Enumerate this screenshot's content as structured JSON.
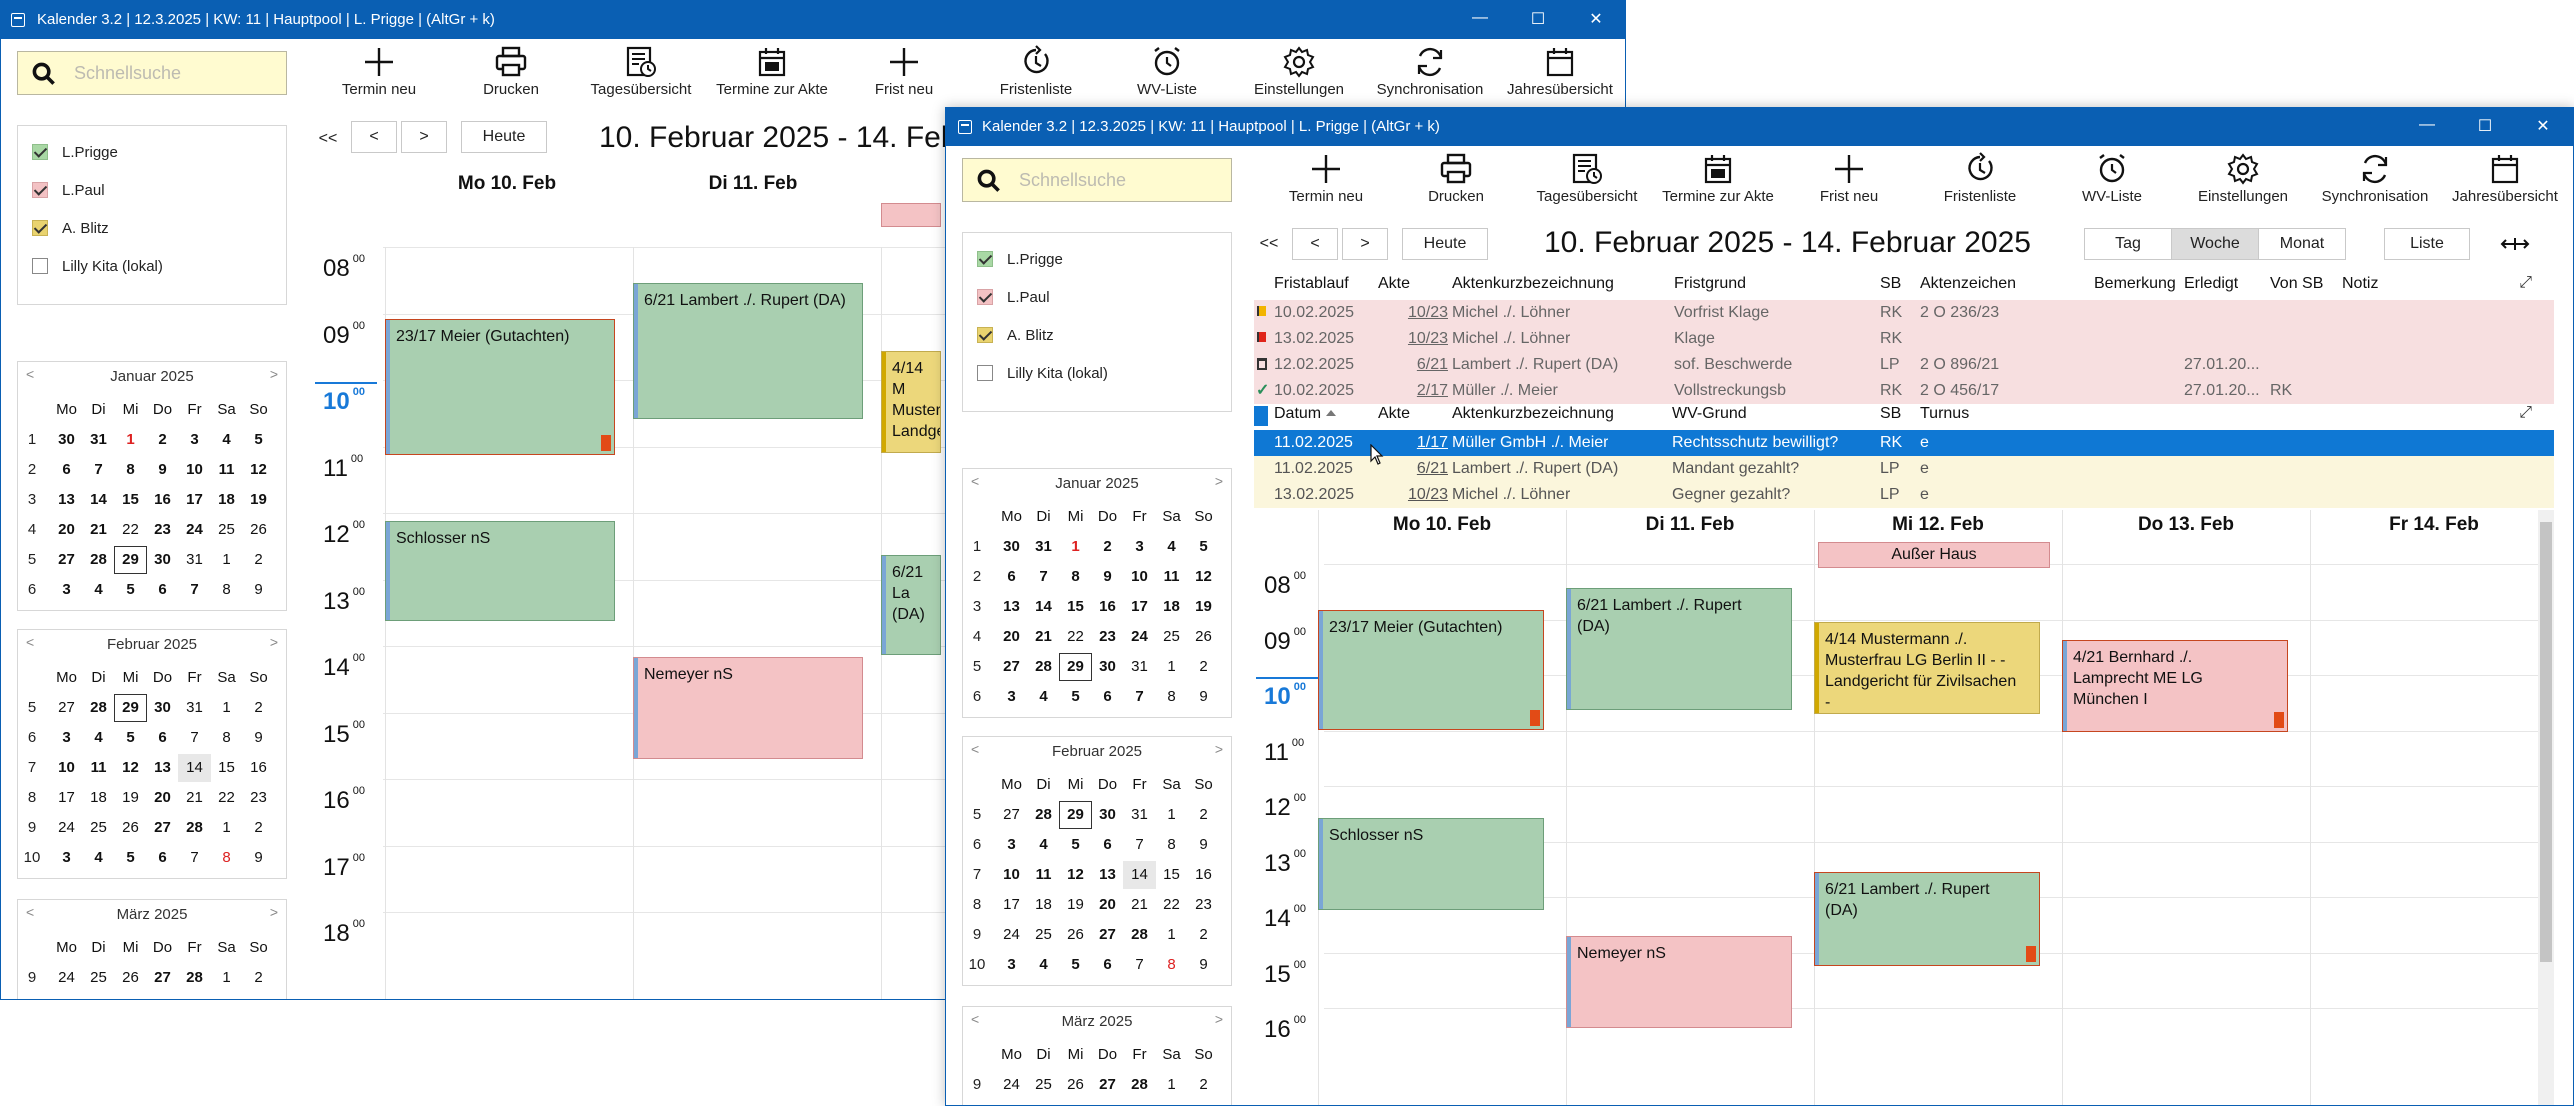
{
  "back_window": {
    "title": "Kalender 3.2 | 12.3.2025 | KW: 11 | Hauptpool | L. Prigge | (AltGr + k)",
    "controls": [
      "—",
      "☐",
      "✕"
    ],
    "search_placeholder": "Schnellsuche",
    "toolbar": [
      "Termin neu",
      "Drucken",
      "Tagesübersicht",
      "Termine zur Akte",
      "Frist neu",
      "Fristenliste",
      "WV-Liste",
      "Einstellungen",
      "Synchronisation",
      "Jahresübersicht"
    ],
    "calendars": [
      {
        "label": "L.Prigge",
        "checked": true,
        "color": "#a9d8a5"
      },
      {
        "label": "L.Paul",
        "checked": true,
        "color": "#f3c2c4"
      },
      {
        "label": "A. Blitz",
        "checked": true,
        "color": "#e9d36f"
      },
      {
        "label": "Lilly Kita (lokal)",
        "checked": false,
        "color": "#ffffff"
      }
    ],
    "nav": {
      "first": "<<",
      "prev": "<",
      "next": ">",
      "today": "Heute"
    },
    "range_title": "10. Februar 2025 - 14. Febr",
    "days": [
      "Mo 10. Feb",
      "Di 11. Feb"
    ],
    "hours": [
      "08",
      "09",
      "10",
      "11",
      "12",
      "13",
      "14",
      "15",
      "16",
      "17",
      "18"
    ],
    "minutes": "00",
    "events": [
      {
        "text": "23/17 Meier (Gutachten)"
      },
      {
        "text": "6/21 Lambert ./. Rupert (DA)"
      },
      {
        "text": "4/14 M\nMuster\nLandge\n-"
      },
      {
        "text": "Schlosser nS"
      },
      {
        "text": "6/21 La\n(DA)"
      },
      {
        "text": "Nemeyer nS"
      }
    ]
  },
  "front_window": {
    "title": "Kalender 3.2 | 12.3.2025 | KW: 11 | Hauptpool | L. Prigge | (AltGr + k)",
    "controls": [
      "—",
      "☐",
      "✕"
    ],
    "search_placeholder": "Schnellsuche",
    "toolbar": [
      "Termin neu",
      "Drucken",
      "Tagesübersicht",
      "Termine zur Akte",
      "Frist neu",
      "Fristenliste",
      "WV-Liste",
      "Einstellungen",
      "Synchronisation",
      "Jahresübersicht"
    ],
    "calendars": [
      {
        "label": "L.Prigge",
        "checked": true,
        "color": "#a9d8a5"
      },
      {
        "label": "L.Paul",
        "checked": true,
        "color": "#f3c2c4"
      },
      {
        "label": "A. Blitz",
        "checked": true,
        "color": "#e9d36f"
      },
      {
        "label": "Lilly Kita (lokal)",
        "checked": false,
        "color": "#ffffff"
      }
    ],
    "nav": {
      "first": "<<",
      "prev": "<",
      "next": ">",
      "today": "Heute"
    },
    "range_title": "10. Februar 2025 - 14. Februar 2025",
    "views": [
      "Tag",
      "Woche",
      "Monat"
    ],
    "active_view": "Woche",
    "list_label": "Liste",
    "fristen_headers": [
      "Fristablauf",
      "Akte",
      "Aktenkurzbezeichnung",
      "Fristgrund",
      "SB",
      "Aktenzeichen",
      "Bemerkung",
      "Erledigt",
      "Von SB",
      "Notiz"
    ],
    "fristen_rows": [
      {
        "icon": "yellow-flag",
        "cells": [
          "10.02.2025",
          "10/23",
          "Michel ./. Löhner",
          "Vorfrist Klage",
          "RK",
          "2 O 236/23",
          "",
          "",
          "",
          ""
        ]
      },
      {
        "icon": "red-flag",
        "cells": [
          "13.02.2025",
          "10/23",
          "Michel ./. Löhner",
          "Klage",
          "RK",
          "",
          "",
          "",
          "",
          ""
        ]
      },
      {
        "icon": "trash",
        "cells": [
          "12.02.2025",
          "6/21",
          "Lambert ./. Rupert (DA)",
          "sof. Beschwerde",
          "LP",
          "2 O 896/21",
          "",
          "27.01.20...",
          "",
          ""
        ]
      },
      {
        "icon": "check",
        "cells": [
          "10.02.2025",
          "2/17",
          "Müller ./. Meier",
          "Vollstreckungsb",
          "RK",
          "2 O 456/17",
          "",
          "27.01.20...",
          "RK",
          ""
        ]
      }
    ],
    "wv_headers": [
      "Datum",
      "Akte",
      "Aktenkurzbezeichnung",
      "WV-Grund",
      "SB",
      "Turnus"
    ],
    "wv_rows": [
      {
        "cells": [
          "11.02.2025",
          "1/17",
          "Müller GmbH ./. Meier",
          "Rechtsschutz bewilligt?",
          "RK",
          "e"
        ]
      },
      {
        "cells": [
          "11.02.2025",
          "6/21",
          "Lambert ./. Rupert (DA)",
          "Mandant gezahlt?",
          "LP",
          "e"
        ]
      },
      {
        "cells": [
          "13.02.2025",
          "10/23",
          "Michel ./. Löhner",
          "Gegner gezahlt?",
          "LP",
          "e"
        ]
      }
    ],
    "days": [
      "Mo 10. Feb",
      "Di 11. Feb",
      "Mi 12. Feb",
      "Do 13. Feb",
      "Fr 14. Feb"
    ],
    "allday_event": "Außer Haus",
    "hours": [
      "08",
      "09",
      "10",
      "11",
      "12",
      "13",
      "14",
      "15",
      "16"
    ],
    "minutes": "00",
    "events": [
      {
        "text": "23/17 Meier (Gutachten)"
      },
      {
        "text": "6/21 Lambert ./. Rupert\n(DA)"
      },
      {
        "text": "4/14 Mustermann ./.\nMusterfrau  LG Berlin II - -\nLandgericht für Zivilsachen\n-"
      },
      {
        "text": "4/21 Bernhard ./.\nLamprecht ME LG\nMünchen I"
      },
      {
        "text": "Schlosser nS"
      },
      {
        "text": "6/21 Lambert ./. Rupert\n(DA)"
      },
      {
        "text": "Nemeyer nS"
      }
    ]
  },
  "mini_calendars": [
    {
      "month": "Januar 2025",
      "weekdays": [
        "Mo",
        "Di",
        "Mi",
        "Do",
        "Fr",
        "Sa",
        "So"
      ],
      "weeks": [
        {
          "wk": "1",
          "days": [
            "30",
            "31",
            "1",
            "2",
            "3",
            "4",
            "5"
          ]
        },
        {
          "wk": "2",
          "days": [
            "6",
            "7",
            "8",
            "9",
            "10",
            "11",
            "12"
          ]
        },
        {
          "wk": "3",
          "days": [
            "13",
            "14",
            "15",
            "16",
            "17",
            "18",
            "19"
          ]
        },
        {
          "wk": "4",
          "days": [
            "20",
            "21",
            "22",
            "23",
            "24",
            "25",
            "26"
          ]
        },
        {
          "wk": "5",
          "days": [
            "27",
            "28",
            "29",
            "30",
            "31",
            "1",
            "2"
          ]
        },
        {
          "wk": "6",
          "days": [
            "3",
            "4",
            "5",
            "6",
            "7",
            "8",
            "9"
          ]
        }
      ]
    },
    {
      "month": "Februar 2025",
      "weekdays": [
        "Mo",
        "Di",
        "Mi",
        "Do",
        "Fr",
        "Sa",
        "So"
      ],
      "weeks": [
        {
          "wk": "5",
          "days": [
            "27",
            "28",
            "29",
            "30",
            "31",
            "1",
            "2"
          ]
        },
        {
          "wk": "6",
          "days": [
            "3",
            "4",
            "5",
            "6",
            "7",
            "8",
            "9"
          ]
        },
        {
          "wk": "7",
          "days": [
            "10",
            "11",
            "12",
            "13",
            "14",
            "15",
            "16"
          ]
        },
        {
          "wk": "8",
          "days": [
            "17",
            "18",
            "19",
            "20",
            "21",
            "22",
            "23"
          ]
        },
        {
          "wk": "9",
          "days": [
            "24",
            "25",
            "26",
            "27",
            "28",
            "1",
            "2"
          ]
        },
        {
          "wk": "10",
          "days": [
            "3",
            "4",
            "5",
            "6",
            "7",
            "8",
            "9"
          ]
        }
      ]
    },
    {
      "month": "März 2025",
      "weekdays": [
        "Mo",
        "Di",
        "Mi",
        "Do",
        "Fr",
        "Sa",
        "So"
      ],
      "weeks": [
        {
          "wk": "9",
          "days": [
            "24",
            "25",
            "26",
            "27",
            "28",
            "1",
            "2"
          ]
        }
      ]
    }
  ],
  "colors": {
    "titlebar": "#0a5fb3",
    "event_green": "#a9cfb0",
    "event_pink": "#f4c3c5",
    "event_yellow": "#ecd77b",
    "selection": "#0f78d4",
    "now_hour": "#1879d8"
  }
}
